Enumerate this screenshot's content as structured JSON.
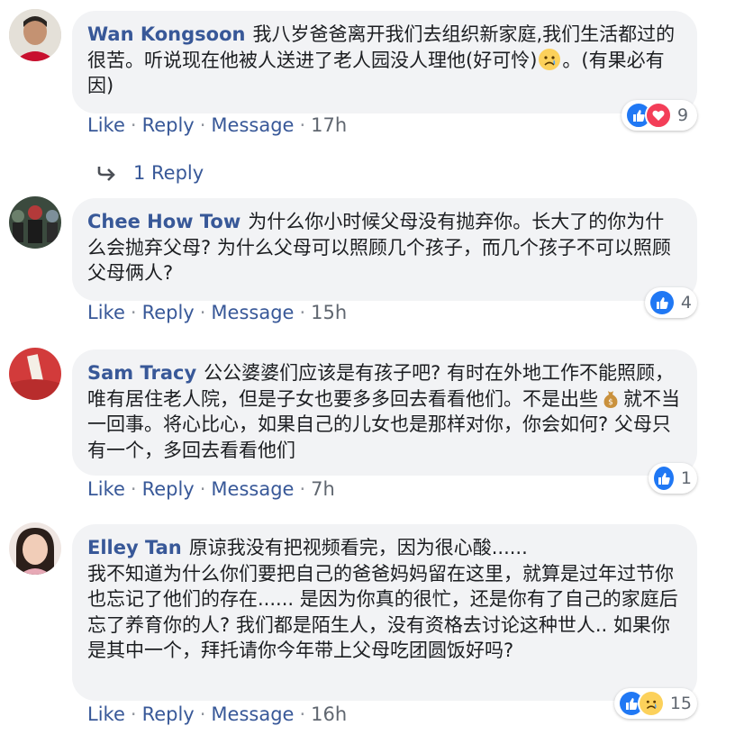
{
  "comments": [
    {
      "author": "Wan Kongsoon",
      "text_parts": [
        "我八岁爸爸离开我们去组织新家庭,我们生活都过的很苦。听说现在他被人送进了老人园没人理他(好可怜)",
        "。(有果必有因)"
      ],
      "inline_emoji": "sad-emoji",
      "reaction_count": "9",
      "reaction_types": [
        "like",
        "love"
      ],
      "like_label": "Like",
      "reply_label": "Reply",
      "message_label": "Message",
      "time": "17h",
      "replies_label": "1 Reply"
    },
    {
      "author": "Chee How Tow",
      "text": "为什么你小时候父母没有抛弃你。长大了的你为什么会抛弃父母? 为什么父母可以照顾几个孩子，而几个孩子不可以照顾父母俩人?",
      "reaction_count": "4",
      "reaction_types": [
        "like"
      ],
      "like_label": "Like",
      "reply_label": "Reply",
      "message_label": "Message",
      "time": "15h"
    },
    {
      "author": "Sam Tracy",
      "text_parts": [
        "公公婆婆们应该是有孩子吧? 有时在外地工作不能照顾，唯有居住老人院，但是子女也要多多回去看看他们。不是出些",
        "就不当一回事。将心比心，如果自己的儿女也是那样对你，你会如何? 父母只有一个，多回去看看他们"
      ],
      "inline_emoji": "money-bag-emoji",
      "reaction_count": "1",
      "reaction_types": [
        "like"
      ],
      "like_label": "Like",
      "reply_label": "Reply",
      "message_label": "Message",
      "time": "7h"
    },
    {
      "author": "Elley Tan",
      "text": "原谅我没有把视频看完，因为很心酸......\n我不知道为什么你们要把自己的爸爸妈妈留在这里，就算是过年过节你也忘记了他们的存在...... 是因为你真的很忙，还是你有了自己的家庭后忘了养育你的人? 我们都是陌生人，没有资格去讨论这种世人.. 如果你是其中一个，拜托请你今年带上父母吃团圆饭好吗?",
      "reaction_count": "15",
      "reaction_types": [
        "like",
        "sad"
      ],
      "like_label": "Like",
      "reply_label": "Reply",
      "message_label": "Message",
      "time": "16h"
    }
  ],
  "colors": {
    "link": "#385898",
    "bubble": "#f2f3f5",
    "like": "#2078f4",
    "love": "#f33e58",
    "sad": "#fcd15b"
  }
}
